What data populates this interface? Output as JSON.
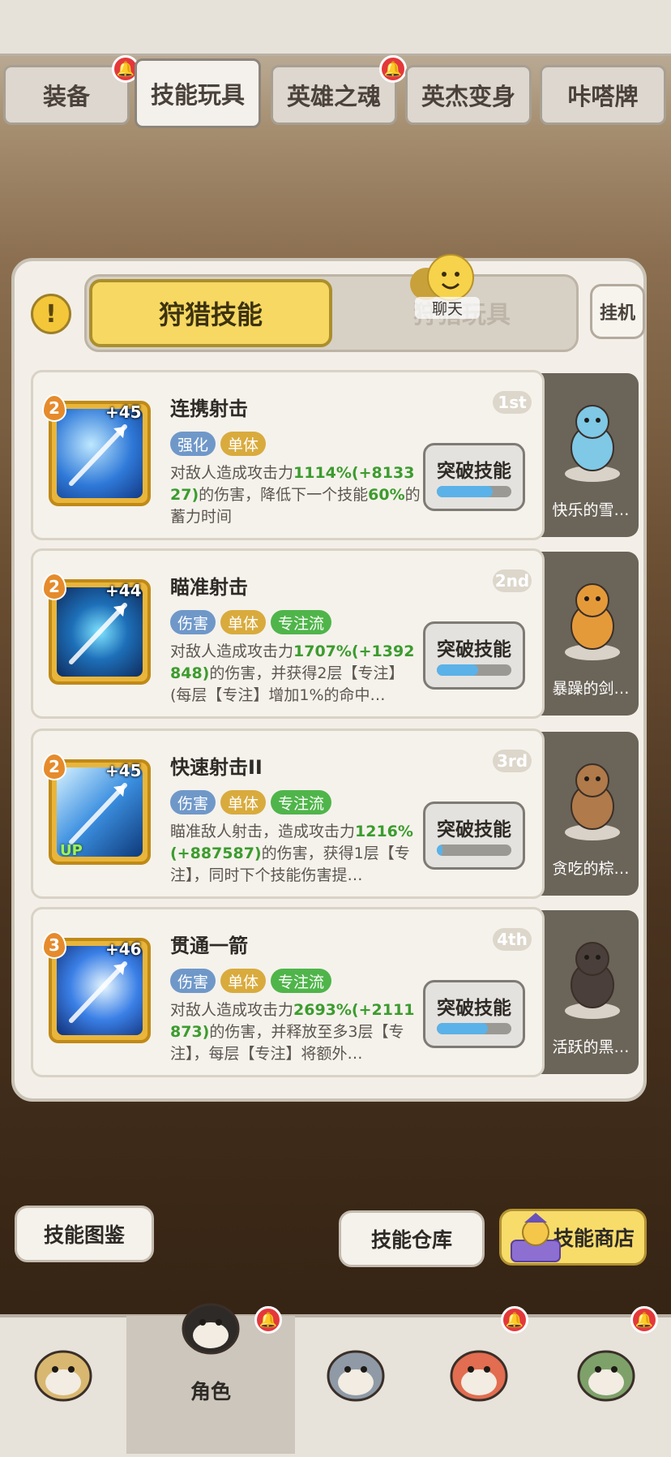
{
  "tabs": [
    {
      "label": "装备",
      "badge": true
    },
    {
      "label": "技能玩具",
      "badge": false,
      "active": true
    },
    {
      "label": "英雄之魂",
      "badge": true
    },
    {
      "label": "英杰变身",
      "badge": false
    },
    {
      "label": "咔嗒牌",
      "badge": false
    }
  ],
  "segment": {
    "active": "狩猎技能",
    "inactive": "狩猎玩具"
  },
  "chat_label": "聊天",
  "idle_button": "挂机",
  "skills": [
    {
      "name": "连携射击",
      "rank": "1st",
      "level": "2",
      "plus": "+45",
      "up": "",
      "tags": [
        "强化",
        "单体"
      ],
      "desc_parts": [
        [
          "对敌人造成攻击力",
          ""
        ],
        [
          "1114%(+813327)",
          "g"
        ],
        [
          "的伤害，降低下一个技能",
          ""
        ],
        [
          "60%",
          "g"
        ],
        [
          "的蓄力时间",
          ""
        ]
      ],
      "break_label": "突破技能",
      "break_progress": 0.75,
      "pet_name": "快乐的雪…"
    },
    {
      "name": "瞄准射击",
      "rank": "2nd",
      "level": "2",
      "plus": "+44",
      "up": "",
      "tags": [
        "伤害",
        "单体",
        "专注流"
      ],
      "desc_parts": [
        [
          "对敌人造成攻击力",
          ""
        ],
        [
          "1707%(+1392848)",
          "g"
        ],
        [
          "的伤害，并获得2层【专注】(每层【专注】增加1%的命中…",
          ""
        ]
      ],
      "break_label": "突破技能",
      "break_progress": 0.55,
      "pet_name": "暴躁的剑…"
    },
    {
      "name": "快速射击II",
      "rank": "3rd",
      "level": "2",
      "plus": "+45",
      "up": "UP",
      "tags": [
        "伤害",
        "单体",
        "专注流"
      ],
      "desc_parts": [
        [
          "瞄准敌人射击，造成攻击力",
          ""
        ],
        [
          "1216%(+887587)",
          "g"
        ],
        [
          "的伤害，获得1层【专注】，同时下个技能伤害提…",
          ""
        ]
      ],
      "break_label": "突破技能",
      "break_progress": 0.08,
      "pet_name": "贪吃的棕…"
    },
    {
      "name": "贯通一箭",
      "rank": "4th",
      "level": "3",
      "plus": "+46",
      "up": "",
      "tags": [
        "伤害",
        "单体",
        "专注流"
      ],
      "desc_parts": [
        [
          "对敌人造成攻击力",
          ""
        ],
        [
          "2693%(+2111873)",
          "g"
        ],
        [
          "的伤害，并释放至多3层【专注】，每层【专注】将额外…",
          ""
        ]
      ],
      "break_label": "突破技能",
      "break_progress": 0.68,
      "pet_name": "活跃的黑…"
    }
  ],
  "bottom_buttons": {
    "codex": "技能图鉴",
    "warehouse": "技能仓库",
    "shop": "技能商店"
  },
  "nav": {
    "active_label": "角色",
    "badges": [
      false,
      true,
      false,
      true,
      true
    ]
  },
  "colors": {
    "accent_gold": "#f6d862",
    "green_value": "#3c9c2e",
    "badge_red": "#e4383b"
  }
}
